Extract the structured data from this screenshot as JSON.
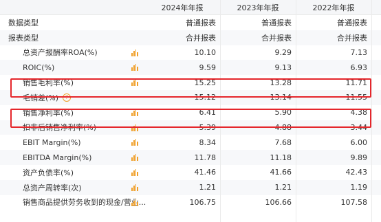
{
  "header": {
    "columns": [
      "2024年年报",
      "2023年年报",
      "2022年年报"
    ]
  },
  "rows": [
    {
      "label": "数据类型",
      "values": [
        "普通报表",
        "普通报表",
        "普通报表"
      ],
      "indent": 0,
      "chart": false
    },
    {
      "label": "报表类型",
      "values": [
        "合并报表",
        "合并报表",
        "合并报表"
      ],
      "indent": 0,
      "chart": false
    },
    {
      "label": "总资产报酬率ROA(%)",
      "values": [
        "10.10",
        "9.29",
        "7.13"
      ],
      "indent": 1,
      "chart": true
    },
    {
      "label": "ROIC(%)",
      "values": [
        "9.59",
        "9.13",
        "6.93"
      ],
      "indent": 1,
      "chart": true
    },
    {
      "label": "销售毛利率(%)",
      "values": [
        "15.25",
        "13.28",
        "11.71"
      ],
      "indent": 1,
      "chart": true
    },
    {
      "label": "毛销差(%)",
      "values": [
        "15.12",
        "13.14",
        "11.55"
      ],
      "indent": 1,
      "chart": false,
      "help": true
    },
    {
      "label": "销售净利率(%)",
      "values": [
        "6.41",
        "5.90",
        "4.38"
      ],
      "indent": 1,
      "chart": true
    },
    {
      "label": "扣非后销售净利率(%)",
      "values": [
        "5.39",
        "4.88",
        "3.44"
      ],
      "indent": 1,
      "chart": true
    },
    {
      "label": "EBIT Margin(%)",
      "values": [
        "8.34",
        "7.68",
        "6.00"
      ],
      "indent": 1,
      "chart": true
    },
    {
      "label": "EBITDA Margin(%)",
      "values": [
        "11.78",
        "11.18",
        "9.89"
      ],
      "indent": 1,
      "chart": true
    },
    {
      "label": "资产负债率(%)",
      "values": [
        "41.46",
        "41.66",
        "42.43"
      ],
      "indent": 1,
      "chart": true
    },
    {
      "label": "总资产周转率(次)",
      "values": [
        "1.21",
        "1.21",
        "1.19"
      ],
      "indent": 1,
      "chart": true
    },
    {
      "label": "销售商品提供劳务收到的现金/营业...",
      "values": [
        "106.75",
        "106.66",
        "107.58"
      ],
      "indent": 1,
      "chart": true
    }
  ],
  "highlighted_rows": [
    "销售毛利率(%)",
    "销售净利率(%)"
  ],
  "colors": {
    "highlight_border": "#e5262b",
    "chart_icon": "#f0a02a"
  }
}
